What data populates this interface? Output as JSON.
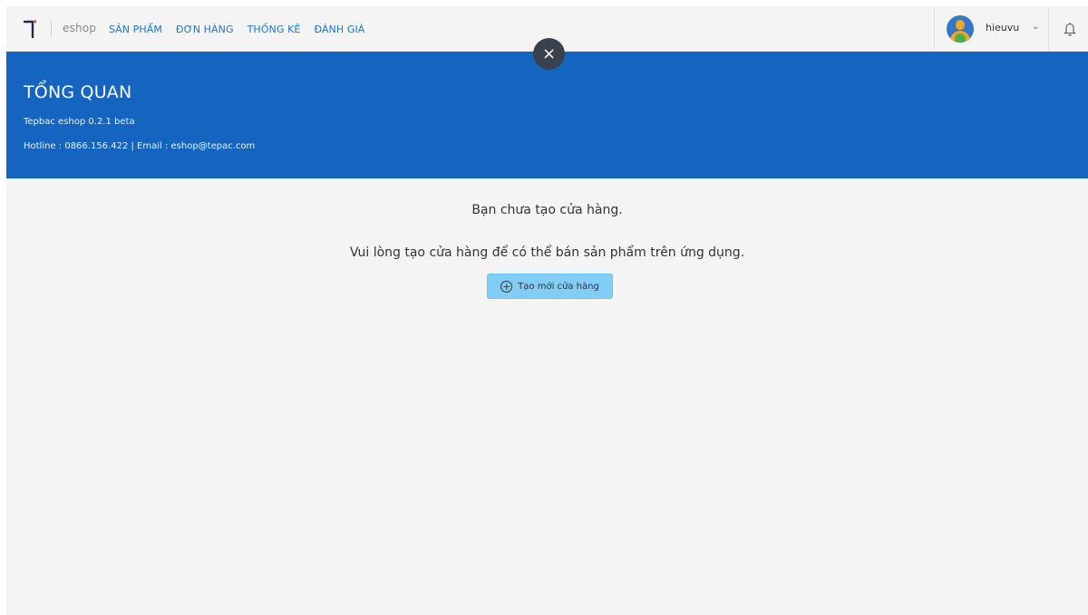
{
  "header": {
    "brand": "eshop",
    "nav": [
      {
        "label": "SẢN PHẨM"
      },
      {
        "label": "ĐƠN HÀNG"
      },
      {
        "label": "THỐNG KÊ"
      },
      {
        "label": "ĐÁNH GIÁ"
      }
    ],
    "user": {
      "name": "hieuvu",
      "chevron": "⌄"
    },
    "icons": {
      "logo": "tepbac-logo-icon",
      "notification": "bell-icon",
      "close": "close-icon"
    }
  },
  "overlay": {
    "close_glyph": "×"
  },
  "hero": {
    "title": "TỔNG QUAN",
    "version": "Tepbac eshop 0.2.1 beta",
    "contact": "Hotline : 0866.156.422 | Email : eshop@tepac.com"
  },
  "main": {
    "message": "Bạn chưa tạo cửa hàng.",
    "instruction": "Vui lòng tạo cửa hàng để có thể bán sản phẩm trên ứng dụng.",
    "create_button": "Tạo mới cửa hàng",
    "create_icon_glyph": "+"
  },
  "colors": {
    "primary": "#1565c0",
    "nav_link": "#1976d2",
    "button_bg": "#81cdf5",
    "close_bg": "#3a414e"
  }
}
